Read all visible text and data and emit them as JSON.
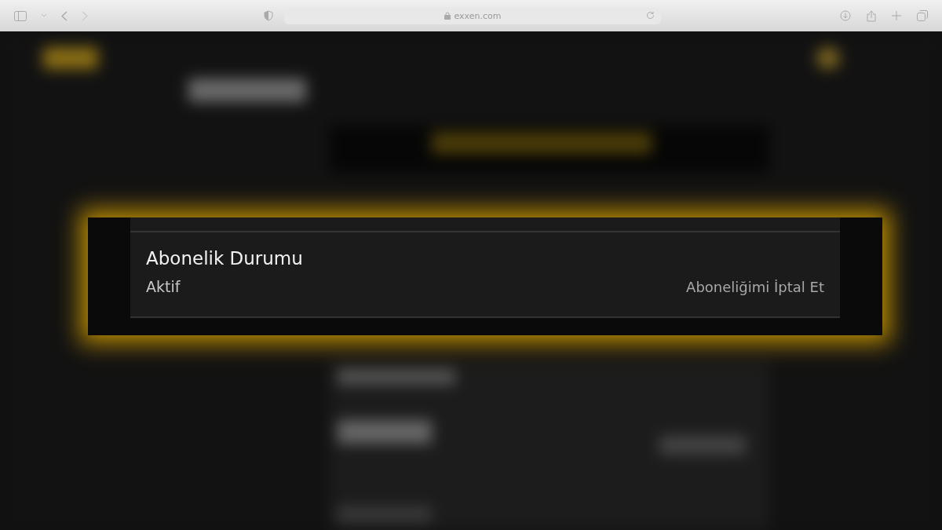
{
  "browser": {
    "address": "exxen.com"
  },
  "subscription": {
    "title": "Abonelik Durumu",
    "status": "Aktif",
    "cancel_link": "Aboneliğimi İptal Et"
  }
}
